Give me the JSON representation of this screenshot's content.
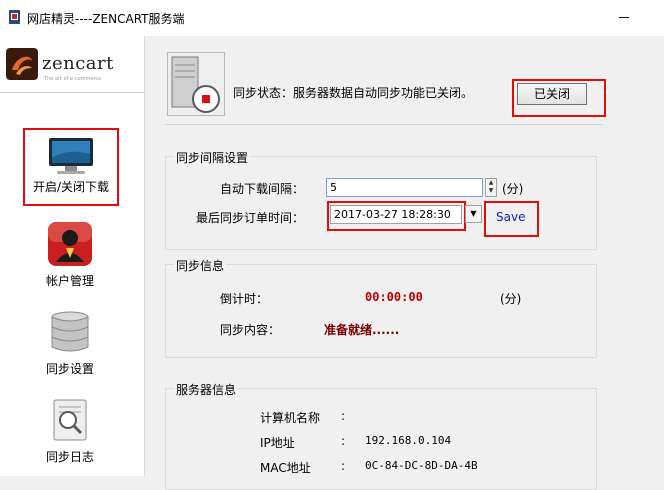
{
  "window": {
    "title": "网店精灵----ZENCART服务端"
  },
  "logo": {
    "text": "zencart",
    "tagline": "The art of e-commerce"
  },
  "sidebar": {
    "items": [
      {
        "label": "开启/关闭下载",
        "icon": "monitor-icon"
      },
      {
        "label": "帐户管理",
        "icon": "account-icon"
      },
      {
        "label": "同步设置",
        "icon": "database-icon"
      },
      {
        "label": "同步日志",
        "icon": "log-icon"
      }
    ]
  },
  "status": {
    "text": "同步状态：服务器数据自动同步功能已关闭。",
    "button_label": "已关闭"
  },
  "interval_group": {
    "title": "同步间隔设置",
    "auto_download_label": "自动下载间隔：",
    "auto_download_value": "5",
    "unit": "(分)",
    "last_sync_label": "最后同步订单时间：",
    "last_sync_value": "2017-03-27 18:28:30",
    "save_label": "Save"
  },
  "sync_info": {
    "title": "同步信息",
    "countdown_label": "倒计时：",
    "countdown_value": "00:00:00",
    "unit": "(分)",
    "content_label": "同步内容：",
    "content_value": "准备就绪......"
  },
  "server_info": {
    "title": "服务器信息",
    "rows": [
      {
        "label": "计算机名称",
        "sep": ":",
        "value": ""
      },
      {
        "label": "IP地址",
        "sep": ":",
        "value": "192.168.0.104"
      },
      {
        "label": "MAC地址",
        "sep": ":",
        "value": "0C-84-DC-8D-DA-4B"
      }
    ]
  },
  "colors": {
    "highlight": "#e30b0b",
    "value_red": "#c00000",
    "save_blue": "#0a1fb8"
  }
}
